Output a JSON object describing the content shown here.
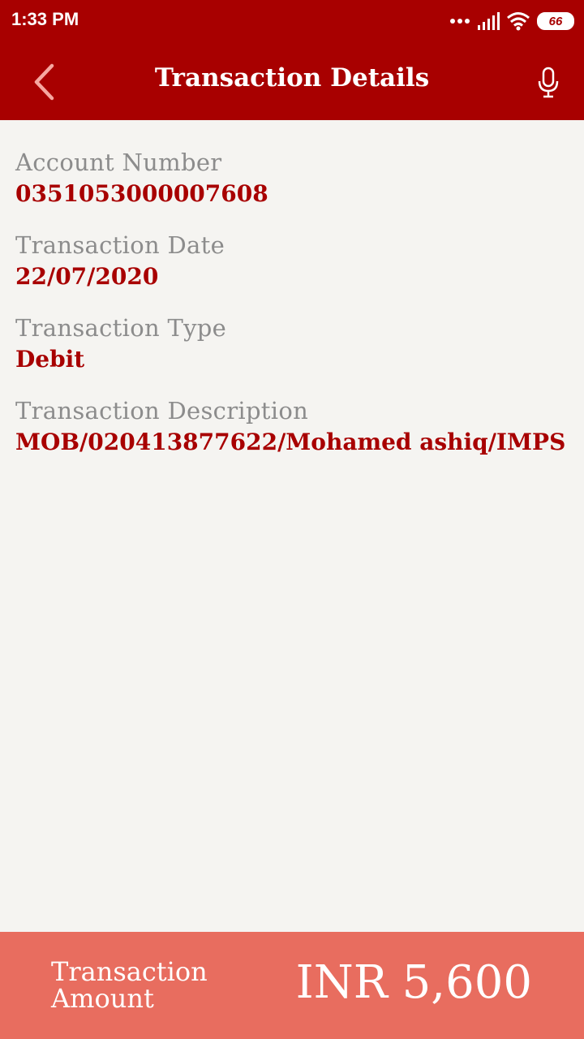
{
  "status_bar": {
    "time": "1:33 PM",
    "battery": "66",
    "icons": [
      "dots-icon",
      "signal-icon",
      "wifi-icon",
      "battery-icon"
    ]
  },
  "app_bar": {
    "title": "Transaction Details",
    "back_icon": "chevron-left-icon",
    "mic_icon": "microphone-icon"
  },
  "details": {
    "account_number": {
      "label": "Account Number",
      "value": "0351053000007608"
    },
    "transaction_date": {
      "label": "Transaction Date",
      "value": "22/07/2020"
    },
    "transaction_type": {
      "label": "Transaction Type",
      "value": "Debit"
    },
    "transaction_description": {
      "label": "Transaction Description",
      "value": "MOB/020413877622/Mohamed ashiq/IMPS"
    }
  },
  "footer": {
    "amount_label": "Transaction Amount",
    "amount_value": "INR 5,600"
  },
  "colors": {
    "header": "#a80000",
    "value_text": "#a80000",
    "label_text": "#8c8c8c",
    "background": "#f5f4f1",
    "footer": "#e86d5f"
  }
}
